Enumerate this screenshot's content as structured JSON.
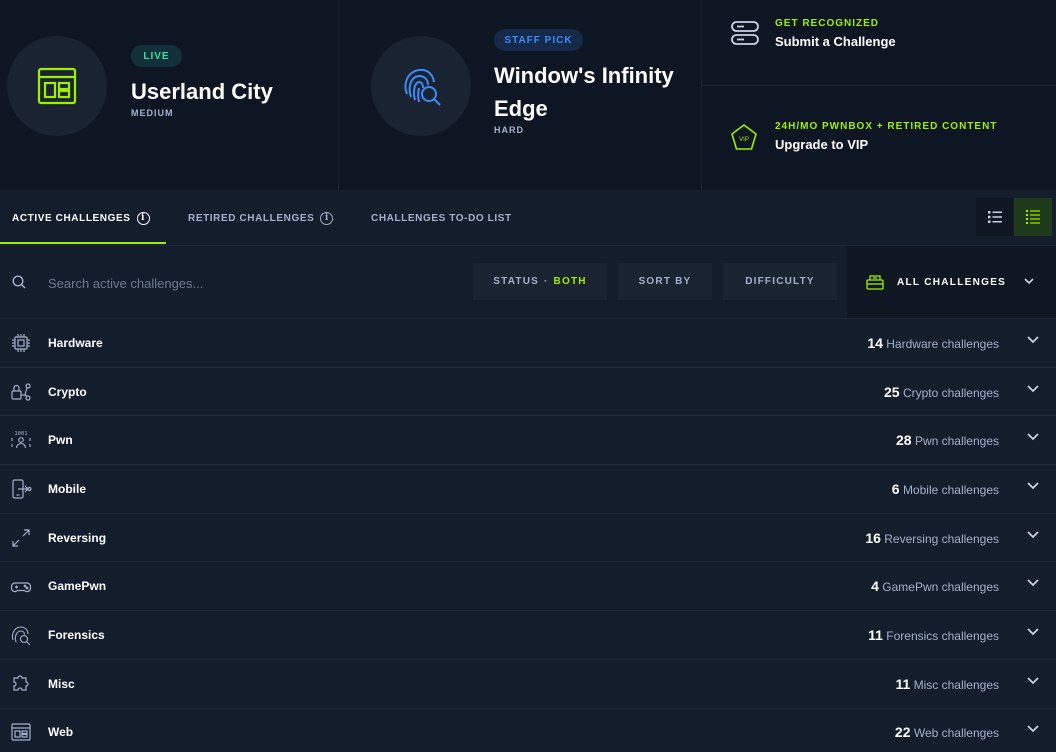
{
  "featured": [
    {
      "badge": "LIVE",
      "title": "Userland City",
      "difficulty": "MEDIUM",
      "icon": "web-window-icon"
    },
    {
      "badge": "STAFF PICK",
      "title": "Window's Infinity Edge",
      "difficulty": "HARD",
      "icon": "fingerprint-search-icon"
    }
  ],
  "promos": [
    {
      "kicker": "GET RECOGNIZED",
      "title": "Submit a Challenge",
      "icon": "server-stack-icon"
    },
    {
      "kicker": "24H/MO PWNBOX + RETIRED CONTENT",
      "title": "Upgrade to VIP",
      "icon": "vip-pentagon-icon"
    }
  ],
  "tabs": [
    {
      "label": "ACTIVE CHALLENGES",
      "active": true
    },
    {
      "label": "RETIRED CHALLENGES",
      "active": false
    },
    {
      "label": "CHALLENGES TO-DO LIST",
      "active": false
    }
  ],
  "view": {
    "list_compact": "list-view-icon",
    "list_detailed": "detailed-list-icon"
  },
  "filters": {
    "search_placeholder": "Search active challenges...",
    "status_label": "STATUS",
    "status_sep": "·",
    "status_value": "BOTH",
    "sort_label": "SORT BY",
    "difficulty_label": "DIFFICULTY",
    "all_label": "ALL CHALLENGES"
  },
  "categories": [
    {
      "name": "Hardware",
      "count": "14",
      "suffix": "Hardware challenges",
      "icon": "chip-icon"
    },
    {
      "name": "Crypto",
      "count": "25",
      "suffix": "Crypto challenges",
      "icon": "crypto-lock-icon"
    },
    {
      "name": "Pwn",
      "count": "28",
      "suffix": "Pwn challenges",
      "icon": "binary-person-icon"
    },
    {
      "name": "Mobile",
      "count": "6",
      "suffix": "Mobile challenges",
      "icon": "mobile-icon"
    },
    {
      "name": "Reversing",
      "count": "16",
      "suffix": "Reversing challenges",
      "icon": "reverse-arrows-icon"
    },
    {
      "name": "GamePwn",
      "count": "4",
      "suffix": "GamePwn challenges",
      "icon": "gamepad-icon"
    },
    {
      "name": "Forensics",
      "count": "11",
      "suffix": "Forensics challenges",
      "icon": "forensics-icon"
    },
    {
      "name": "Misc",
      "count": "11",
      "suffix": "Misc challenges",
      "icon": "puzzle-icon"
    },
    {
      "name": "Web",
      "count": "22",
      "suffix": "Web challenges",
      "icon": "web-window-icon"
    }
  ],
  "colors": {
    "accent": "#9fef00",
    "live": "#2ee6a4",
    "staff": "#3b8cf6",
    "bg": "#141d2b"
  }
}
